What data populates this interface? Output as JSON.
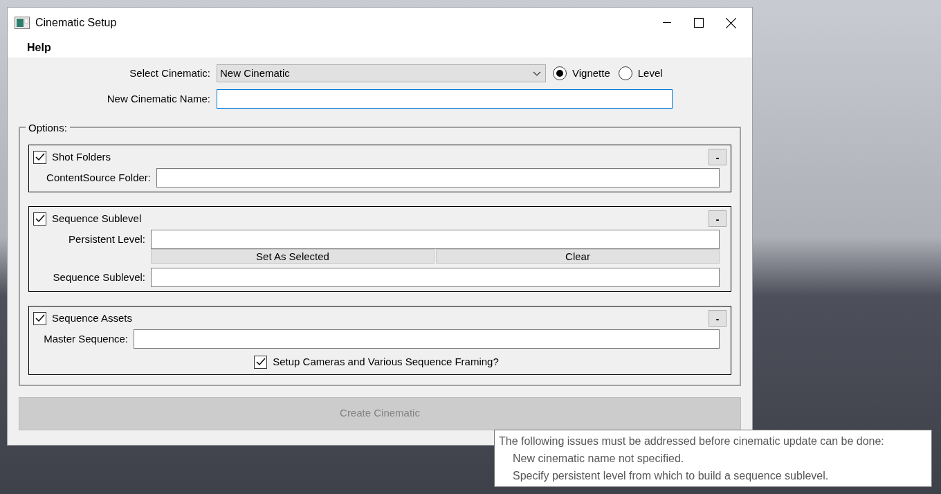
{
  "window": {
    "title": "Cinematic Setup"
  },
  "menu": [
    "Help"
  ],
  "select_cinematic": {
    "label": "Select Cinematic:",
    "value": "New Cinematic",
    "radios": [
      {
        "label": "Vignette",
        "selected": true
      },
      {
        "label": "Level",
        "selected": false
      }
    ]
  },
  "new_cinematic_name": {
    "label": "New Cinematic Name:"
  },
  "options": {
    "label": "Options:",
    "sections": [
      {
        "title": "Shot Folders",
        "checked": true,
        "collapse": "-",
        "rows": [
          {
            "kind": "field",
            "label": "ContentSource Folder:"
          }
        ]
      },
      {
        "title": "Sequence Sublevel",
        "checked": true,
        "collapse": "-",
        "rows": [
          {
            "kind": "field",
            "label": "Persistent Level:"
          },
          {
            "kind": "buttons",
            "buttons": [
              "Set As Selected",
              "Clear"
            ]
          },
          {
            "kind": "field",
            "label": "Sequence Sublevel:"
          }
        ]
      },
      {
        "title": "Sequence Assets",
        "checked": true,
        "collapse": "-",
        "rows": [
          {
            "kind": "field",
            "label": "Master Sequence:"
          },
          {
            "kind": "checkbox",
            "label": "Setup Cameras and Various Sequence Framing?",
            "checked": true
          }
        ]
      }
    ]
  },
  "create_button": {
    "label": "Create Cinematic",
    "disabled": true
  },
  "tooltip": {
    "heading": "The following issues must be addressed before cinematic update can be done:",
    "issues": [
      "New cinematic name not specified.",
      "Specify persistent level from which to build a sequence sublevel."
    ]
  }
}
